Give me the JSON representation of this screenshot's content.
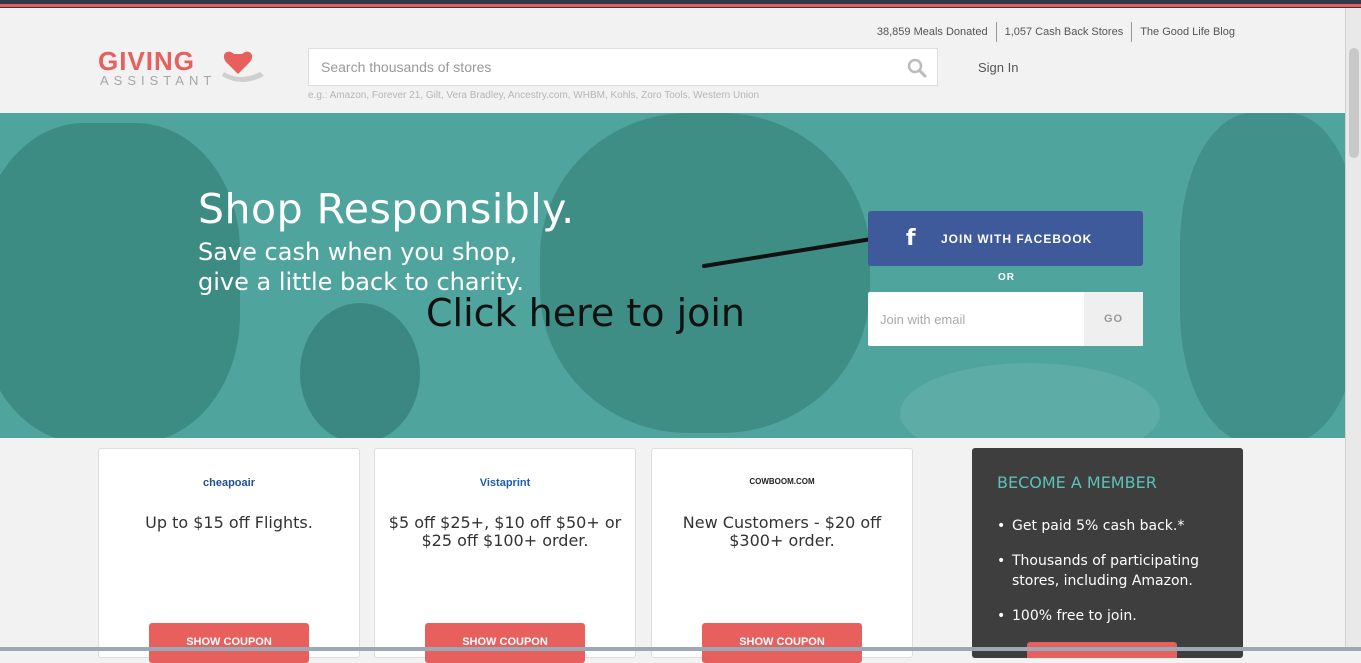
{
  "header": {
    "logo_line1": "GIVING",
    "logo_line2": "ASSISTANT",
    "top_links": [
      "38,859 Meals Donated",
      "1,057 Cash Back Stores",
      "The Good Life Blog"
    ],
    "search_placeholder": "Search thousands of stores",
    "search_hint": "e.g.: Amazon, Forever 21, Gilt, Vera Bradley, Ancestry.com, WHBM, Kohls, Zoro Tools, Western Union",
    "signin_label": "Sign In"
  },
  "hero": {
    "title": "Shop Responsibly.",
    "subtitle_line1": "Save cash when you shop,",
    "subtitle_line2": "give a little back to charity.",
    "annotation": "Click here to join",
    "facebook_icon": "f",
    "facebook_label": "JOIN WITH FACEBOOK",
    "or_label": "OR",
    "email_placeholder": "Join with email",
    "go_label": "GO"
  },
  "coupons": [
    {
      "brand": "cheapoair",
      "offer": "Up to $15 off Flights.",
      "button": "SHOW COUPON"
    },
    {
      "brand": "Vistaprint",
      "offer": "$5 off $25+, $10 off $50+ or $25 off $100+ order.",
      "button": "SHOW COUPON"
    },
    {
      "brand": "COWBOOM.COM",
      "offer": "New Customers - $20 off $300+ order.",
      "button": "SHOW COUPON"
    }
  ],
  "member": {
    "title": "BECOME A MEMBER",
    "items": [
      "Get paid 5% cash back.*",
      "Thousands of participating stores, including Amazon.",
      "100% free to join."
    ]
  },
  "colors": {
    "brand_coral": "#e8605e",
    "hero_teal": "#4fa49d",
    "facebook_blue": "#3f5a9a",
    "member_bg": "#3e3e3e",
    "member_title": "#5cc1b8"
  },
  "icons": [
    "heart-hand-icon",
    "search-icon",
    "facebook-icon"
  ]
}
